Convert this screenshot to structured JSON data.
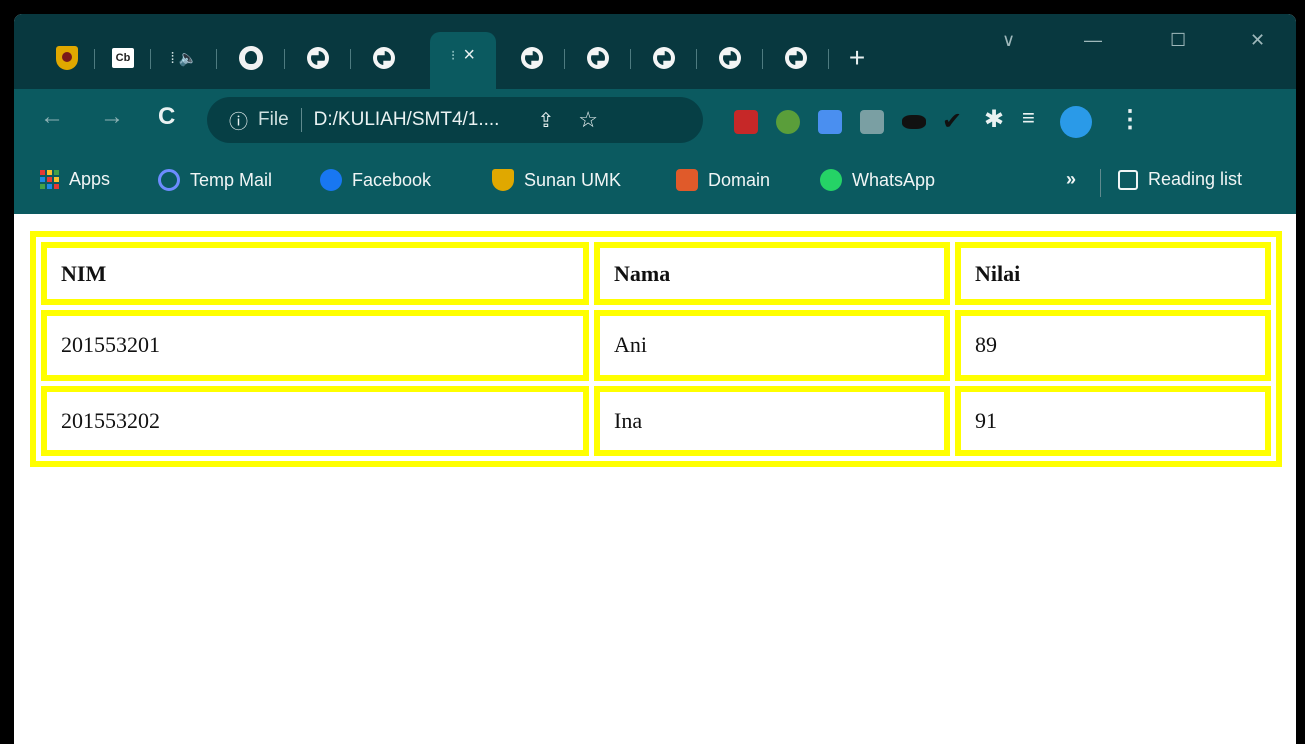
{
  "browser": {
    "tabs": [
      {
        "icon": "sunan-umk-icon"
      },
      {
        "icon": "cb-icon",
        "text": "Cb"
      },
      {
        "icon": "audio-icon",
        "text": "⁞ 🔈"
      },
      {
        "icon": "github-icon"
      },
      {
        "icon": "globe-icon"
      },
      {
        "icon": "globe-icon"
      },
      {
        "icon": "active-tab",
        "text": "⁝",
        "close": "×"
      },
      {
        "icon": "globe-icon"
      },
      {
        "icon": "globe-icon"
      },
      {
        "icon": "globe-icon"
      },
      {
        "icon": "globe-icon"
      },
      {
        "icon": "globe-icon"
      }
    ],
    "new_tab": "+",
    "window_controls": {
      "dropdown": "∨",
      "minimize": "—",
      "maximize": "☐",
      "close": "✕"
    },
    "address": {
      "info": "ⓘ",
      "scheme": "File",
      "url": "D:/KULIAH/SMT4/1...."
    },
    "bookmarks": [
      {
        "label": "Apps",
        "color": "#e33"
      },
      {
        "label": "Temp Mail",
        "color": "#4a6cf7"
      },
      {
        "label": "Facebook",
        "color": "#1877f2"
      },
      {
        "label": "Sunan UMK",
        "color": "#e0a800"
      },
      {
        "label": "Domain",
        "color": "#e05a2a"
      },
      {
        "label": "WhatsApp",
        "color": "#25d366"
      }
    ],
    "more": "»",
    "reading_list": "Reading list"
  },
  "table": {
    "headers": [
      "NIM",
      "Nama",
      "Nilai"
    ],
    "rows": [
      [
        "201553201",
        "Ani",
        "89"
      ],
      [
        "201553202",
        "Ina",
        "91"
      ]
    ]
  },
  "colors": {
    "accent": "#ffff00",
    "toolbar": "#0b5a60",
    "tabstrip": "#08383f"
  }
}
